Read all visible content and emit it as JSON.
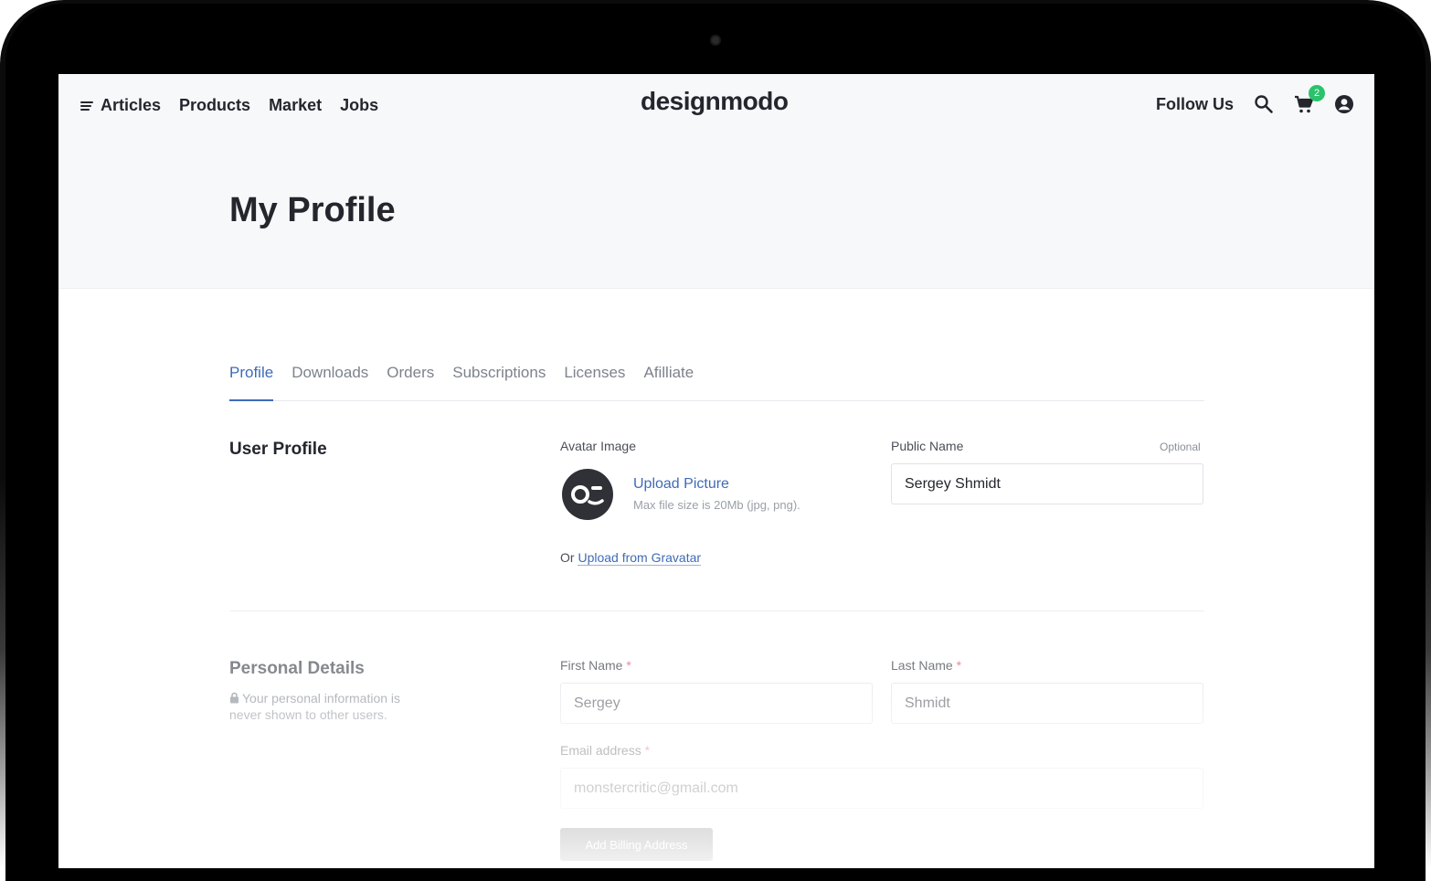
{
  "nav": {
    "items": [
      "Articles",
      "Products",
      "Market",
      "Jobs"
    ],
    "logo": "designmodo",
    "follow": "Follow Us",
    "cart_count": "2"
  },
  "page": {
    "title": "My Profile"
  },
  "tabs": [
    "Profile",
    "Downloads",
    "Orders",
    "Subscriptions",
    "Licenses",
    "Afilliate"
  ],
  "user_profile": {
    "title": "User Profile",
    "avatar_label": "Avatar Image",
    "upload_label": "Upload Picture",
    "upload_hint": "Max file size is 20Mb (jpg, png).",
    "or": "Or",
    "gravatar_label": "Upload from Gravatar",
    "public_name_label": "Public Name",
    "optional": "Optional",
    "public_name_value": "Sergey Shmidt"
  },
  "personal": {
    "title": "Personal Details",
    "note": "Your personal information is never shown to other users.",
    "first_name_label": "First Name",
    "first_name_value": "Sergey",
    "last_name_label": "Last Name",
    "last_name_value": "Shmidt",
    "email_label": "Email address",
    "email_value": "monstercritic@gmail.com",
    "required_mark": "*",
    "add_billing": "Add Billing Address"
  },
  "colors": {
    "accent": "#3f6bb8",
    "badge": "#2bc26b",
    "text": "#23262d"
  }
}
